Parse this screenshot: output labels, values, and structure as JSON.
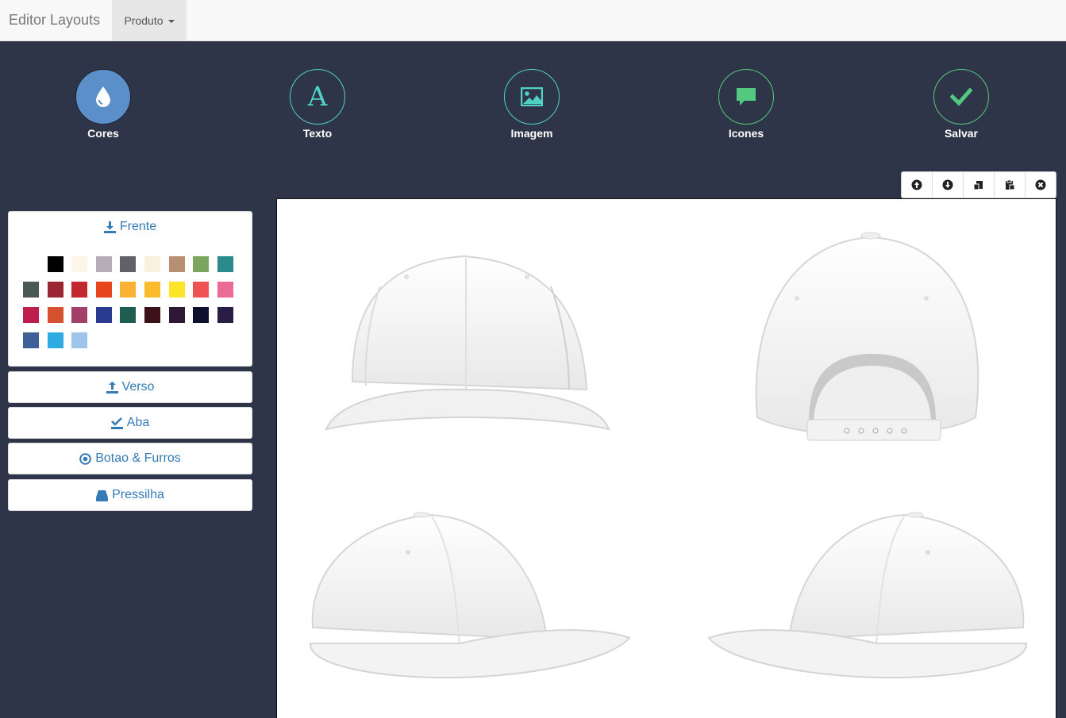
{
  "navbar": {
    "brand": "Editor Layouts",
    "dropdown_label": "Produto"
  },
  "tools": [
    {
      "label": "Cores",
      "icon": "droplet-icon"
    },
    {
      "label": "Texto",
      "icon": "letter-a-icon",
      "glyph": "A"
    },
    {
      "label": "Imagem",
      "icon": "image-icon"
    },
    {
      "label": "Icones",
      "icon": "comment-icon"
    },
    {
      "label": "Salvar",
      "icon": "check-icon"
    }
  ],
  "mini_toolbar": [
    "arrow-up-circle-icon",
    "arrow-down-circle-icon",
    "copy-icon",
    "paste-icon",
    "remove-circle-icon"
  ],
  "sections": {
    "frente": {
      "label": "Frente",
      "icon": "download-icon"
    },
    "verso": {
      "label": "Verso",
      "icon": "upload-icon"
    },
    "aba": {
      "label": "Aba",
      "icon": "check-underline-icon"
    },
    "botao": {
      "label": "Botao & Furros",
      "icon": "record-icon"
    },
    "pressilha": {
      "label": "Pressilha",
      "icon": "hdd-icon"
    }
  },
  "colors": {
    "background": "#2f3549",
    "accent_blue": "#5b8fc9",
    "accent_teal": "#4fd1c5",
    "accent_green": "#52c97e",
    "link": "#337ab7"
  },
  "swatches": [
    "#ffffff",
    "#000000",
    "#fdf6e8",
    "#b4adb7",
    "#636167",
    "#f7f1de",
    "#b88f73",
    "#7ca65f",
    "#2a8a8c",
    "#4a5a53",
    "#9a2533",
    "#c1272d",
    "#e6461e",
    "#f9b233",
    "#fbbc2c",
    "#ffe529",
    "#ef5253",
    "#ea6b93",
    "#be1e4b",
    "#d4522f",
    "#a23f6a",
    "#293b8f",
    "#1f5c52",
    "#3c1218",
    "#2e1836",
    "#0f102d",
    "#291d45",
    "#3f5f97",
    "#2eabe2",
    "#9fc4ec"
  ]
}
